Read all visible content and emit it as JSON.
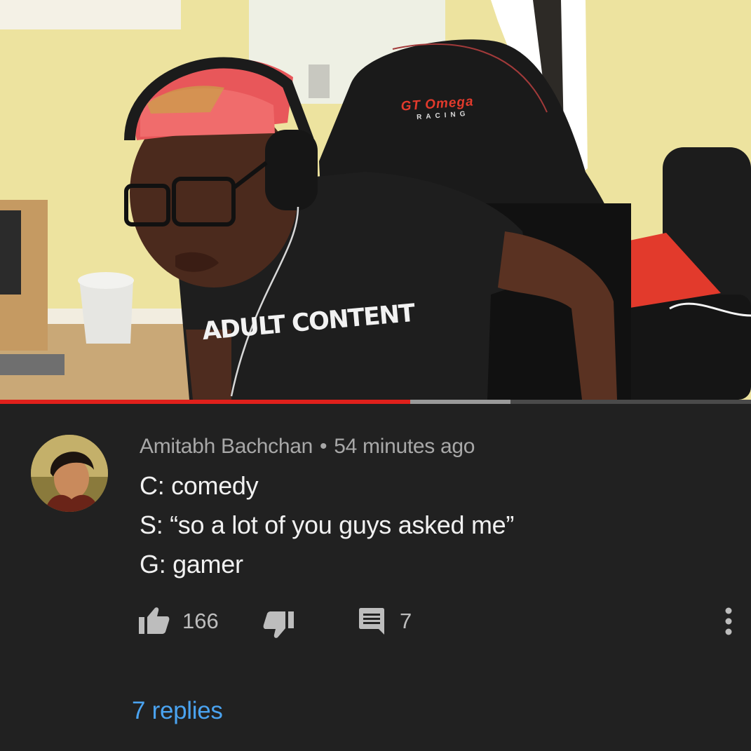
{
  "video": {
    "chair_brand": "GT Omega",
    "chair_sub": "RACING",
    "shirt_text": "ADULT CONTENT",
    "progress_played_fraction": 0.546,
    "progress_buffered_fraction": 0.68
  },
  "comment": {
    "author": "Amitabh Bachchan",
    "separator": "•",
    "time": "54 minutes ago",
    "lines": [
      "C: comedy",
      "S: “so a lot of you guys asked me”",
      "G: gamer"
    ],
    "likes": "166",
    "replies_count": "7",
    "replies_link": "7 replies"
  },
  "colors": {
    "background": "#212121",
    "link": "#4aa3f0",
    "progress_played": "#e0201b"
  },
  "icons": {
    "like": "thumb-up-icon",
    "dislike": "thumb-down-icon",
    "reply": "comment-icon",
    "more": "more-vert-icon"
  }
}
